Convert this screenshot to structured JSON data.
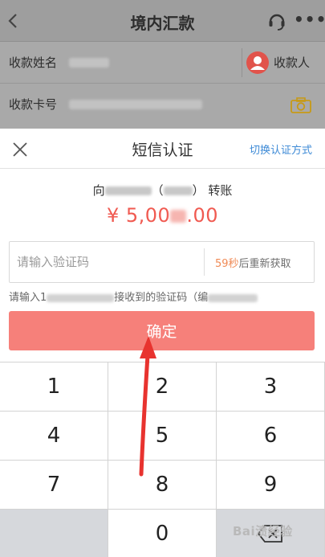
{
  "header": {
    "title": "境内汇款",
    "back_icon": "chevron-left-icon",
    "service_icon": "headset-icon",
    "more_label": "•••"
  },
  "form": {
    "name_label": "收款姓名",
    "payee_label": "收款人",
    "card_label": "收款卡号"
  },
  "sheet": {
    "title": "短信认证",
    "switch_label": "切换认证方式",
    "transfer_prefix": "向",
    "transfer_paren_open": "（",
    "transfer_paren_close": "）",
    "transfer_suffix": "转账",
    "amount_prefix": "¥ 5,00",
    "amount_suffix": ".00",
    "code_placeholder": "请输入验证码",
    "resend_seconds": "59秒",
    "resend_text": "后重新获取",
    "hint_prefix": "请输入1",
    "hint_middle": "接收到的验证码（编",
    "confirm_label": "确定"
  },
  "keypad": {
    "keys": [
      "1",
      "2",
      "3",
      "4",
      "5",
      "6",
      "7",
      "8",
      "9",
      "",
      "0",
      "backspace"
    ]
  },
  "watermark": "Bai渍经验",
  "colors": {
    "accent_red": "#f05a51",
    "confirm_bg": "#f6807a",
    "link_blue": "#3d8ad6",
    "avatar_red": "#e1534b"
  }
}
